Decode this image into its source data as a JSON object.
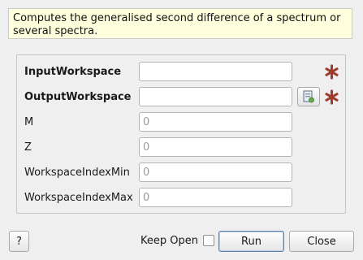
{
  "description": "Computes the generalised second difference of a spectrum or several spectra.",
  "properties": [
    {
      "label": "InputWorkspace",
      "value": "",
      "placeholder": "",
      "required": true,
      "bold": true
    },
    {
      "label": "OutputWorkspace",
      "value": "",
      "placeholder": "",
      "required": true,
      "bold": true
    },
    {
      "label": "M",
      "value": "",
      "placeholder": "0",
      "required": false,
      "bold": false
    },
    {
      "label": "Z",
      "value": "",
      "placeholder": "0",
      "required": false,
      "bold": false
    },
    {
      "label": "WorkspaceIndexMin",
      "value": "",
      "placeholder": "0",
      "required": false,
      "bold": false
    },
    {
      "label": "WorkspaceIndexMax",
      "value": "",
      "placeholder": "0",
      "required": false,
      "bold": false
    }
  ],
  "icons": {
    "required": "red-asterisk-icon",
    "browse": "workspace-browse-icon"
  },
  "colors": {
    "required_star": "#a23a2a",
    "description_bg": "#ffffdd"
  },
  "footer": {
    "help_label": "?",
    "keep_open_label": "Keep Open",
    "keep_open_checked": false,
    "run_label": "Run",
    "close_label": "Close"
  }
}
